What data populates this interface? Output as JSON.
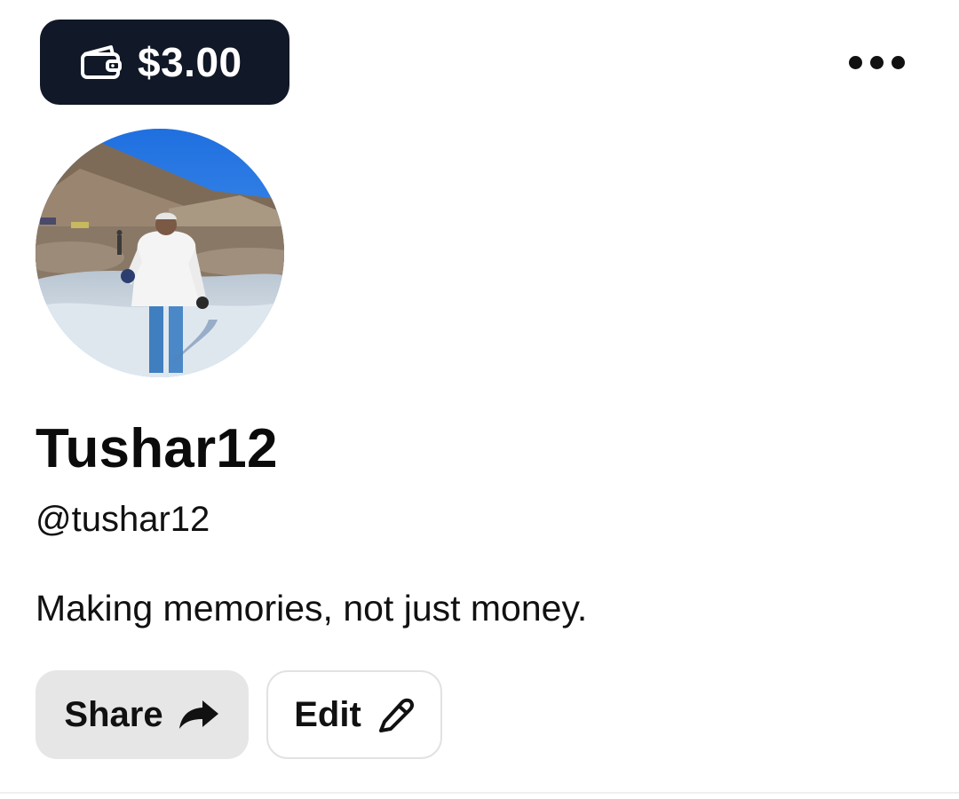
{
  "balance": {
    "amount": "$3.00",
    "icon": "wallet-icon",
    "background_color": "#111827"
  },
  "menu": {
    "icon": "more-horizontal-icon"
  },
  "profile": {
    "avatar_alt": "profile-photo",
    "display_name": "Tushar12",
    "handle": "@tushar12",
    "bio": "Making memories, not just money."
  },
  "actions": {
    "share_label": "Share",
    "share_icon": "share-arrow-icon",
    "edit_label": "Edit",
    "edit_icon": "pencil-icon"
  }
}
